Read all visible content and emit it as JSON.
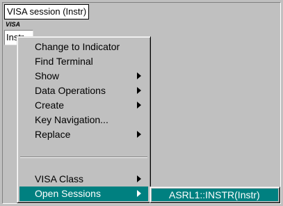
{
  "session_label": "VISA session (Instr)",
  "control": {
    "logo_text": "VISA",
    "value": "Instr"
  },
  "menu": {
    "items": [
      {
        "label": "Change to Indicator",
        "submenu": false
      },
      {
        "label": "Find Terminal",
        "submenu": false
      },
      {
        "label": "Show",
        "submenu": true
      },
      {
        "label": "Data Operations",
        "submenu": true
      },
      {
        "label": "Create",
        "submenu": true
      },
      {
        "label": "Key Navigation...",
        "submenu": false
      },
      {
        "label": "Replace",
        "submenu": true
      },
      {
        "label": "VISA Class",
        "submenu": true
      },
      {
        "label": "Open Sessions",
        "submenu": true,
        "highlighted": true
      }
    ]
  },
  "submenu": {
    "items": [
      {
        "label": "ASRL1::INSTR(Instr)"
      }
    ]
  },
  "colors": {
    "highlight": "#008080",
    "face": "#c0c0c0"
  }
}
